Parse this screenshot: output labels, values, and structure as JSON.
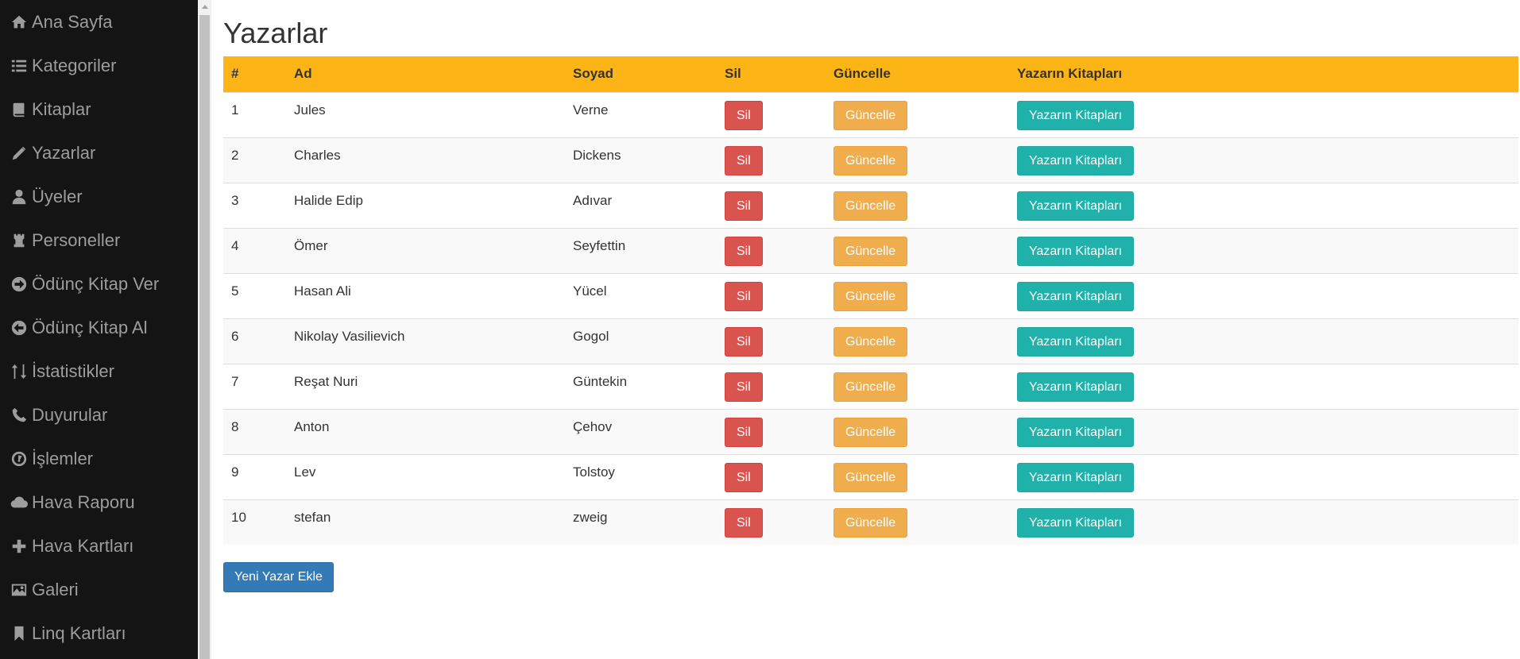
{
  "sidebar": {
    "items": [
      {
        "label": "Ana Sayfa",
        "icon": "home-icon"
      },
      {
        "label": "Kategoriler",
        "icon": "list-icon"
      },
      {
        "label": "Kitaplar",
        "icon": "book-icon"
      },
      {
        "label": "Yazarlar",
        "icon": "pencil-icon"
      },
      {
        "label": "Üyeler",
        "icon": "user-icon"
      },
      {
        "label": "Personeller",
        "icon": "chess-tower-icon"
      },
      {
        "label": "Ödünç Kitap Ver",
        "icon": "circle-arrow-right-icon"
      },
      {
        "label": "Ödünç Kitap Al",
        "icon": "circle-arrow-left-icon"
      },
      {
        "label": "İstatistikler",
        "icon": "sort-icon"
      },
      {
        "label": "Duyurular",
        "icon": "phone-icon"
      },
      {
        "label": "İşlemler",
        "icon": "dashboard-icon"
      },
      {
        "label": "Hava Raporu",
        "icon": "cloud-icon"
      },
      {
        "label": "Hava Kartları",
        "icon": "plus-icon"
      },
      {
        "label": "Galeri",
        "icon": "picture-icon"
      },
      {
        "label": "Linq Kartları",
        "icon": "bookmark-icon"
      }
    ]
  },
  "main": {
    "title": "Yazarlar",
    "table": {
      "headers": [
        "#",
        "Ad",
        "Soyad",
        "Sil",
        "Güncelle",
        "Yazarın Kitapları"
      ],
      "rows": [
        {
          "id": "1",
          "first_name": "Jules",
          "last_name": "Verne"
        },
        {
          "id": "2",
          "first_name": "Charles",
          "last_name": "Dickens"
        },
        {
          "id": "3",
          "first_name": "Halide Edip",
          "last_name": "Adıvar"
        },
        {
          "id": "4",
          "first_name": "Ömer",
          "last_name": "Seyfettin"
        },
        {
          "id": "5",
          "first_name": "Hasan Ali",
          "last_name": "Yücel"
        },
        {
          "id": "6",
          "first_name": "Nikolay Vasilievich",
          "last_name": "Gogol"
        },
        {
          "id": "7",
          "first_name": "Reşat Nuri",
          "last_name": "Güntekin"
        },
        {
          "id": "8",
          "first_name": "Anton",
          "last_name": "Çehov"
        },
        {
          "id": "9",
          "first_name": "Lev",
          "last_name": "Tolstoy"
        },
        {
          "id": "10",
          "first_name": "stefan",
          "last_name": "zweig"
        }
      ],
      "delete_label": "Sil",
      "update_label": "Güncelle",
      "books_label": "Yazarın Kitapları"
    },
    "add_button_label": "Yeni Yazar Ekle"
  },
  "colors": {
    "sidebar_bg": "#141414",
    "sidebar_text": "#9d9d9d",
    "table_header_bg": "#fdb416",
    "delete_button": "#d9534f",
    "update_button": "#f0ad4e",
    "books_button": "#20b2aa",
    "add_button": "#337ab7"
  }
}
